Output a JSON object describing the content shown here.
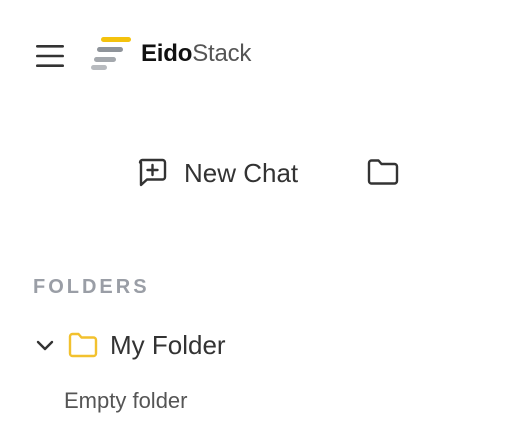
{
  "header": {
    "brand_bold": "Eido",
    "brand_light": "Stack",
    "menu_icon": "hamburger-icon",
    "logo_colors": [
      "#f4c20d",
      "#9aa0a6"
    ]
  },
  "actions": {
    "new_chat_label": "New Chat",
    "new_chat_icon": "chat-plus-icon",
    "new_folder_icon": "folder-icon"
  },
  "folders": {
    "section_title": "FOLDERS",
    "items": [
      {
        "name": "My Folder",
        "expanded": true,
        "empty_text": "Empty folder",
        "icon_color": "#f2c12e"
      }
    ]
  }
}
